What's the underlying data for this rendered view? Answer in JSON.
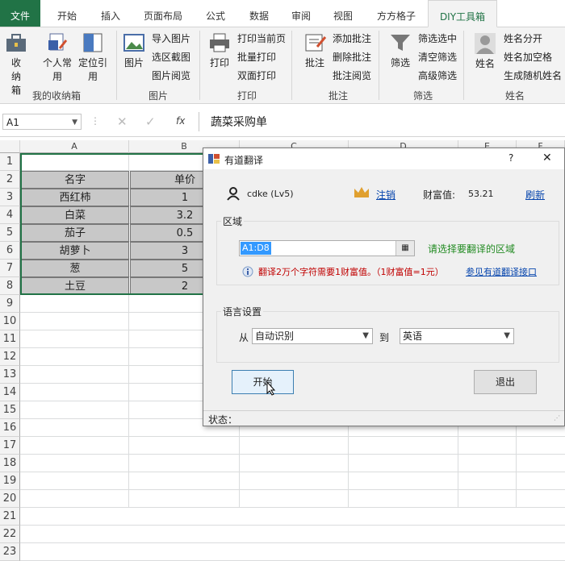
{
  "ribbon_tabs": [
    "文件",
    "开始",
    "插入",
    "页面布局",
    "公式",
    "数据",
    "审阅",
    "视图",
    "方方格子",
    "DIY工具箱"
  ],
  "ribbon": {
    "group1": {
      "big": [
        "收纳箱",
        "个人常用",
        "定位引用"
      ],
      "label": "我的收纳箱"
    },
    "group2": {
      "big": "图片",
      "small": [
        "导入图片",
        "选区截图",
        "图片阅览"
      ],
      "label": "图片"
    },
    "group3": {
      "big": "打印",
      "small": [
        "打印当前页",
        "批量打印",
        "双面打印"
      ],
      "label": "打印"
    },
    "group4": {
      "big": "批注",
      "small": [
        "添加批注",
        "删除批注",
        "批注阅览"
      ],
      "label": "批注"
    },
    "group5": {
      "big": "筛选",
      "small": [
        "筛选选中",
        "清空筛选",
        "高级筛选"
      ],
      "label": "筛选"
    },
    "group6": {
      "big": "姓名",
      "small": [
        "姓名分开",
        "姓名加空格",
        "生成随机姓名"
      ],
      "label": "姓名"
    }
  },
  "formula_bar": {
    "name_box": "A1",
    "fx": "fx",
    "value": "蔬菜采购单"
  },
  "columns": [
    "A",
    "B",
    "C",
    "D",
    "E",
    "F"
  ],
  "rows": [
    "1",
    "2",
    "3",
    "4",
    "5",
    "6",
    "7",
    "8",
    "9",
    "10",
    "11",
    "12",
    "13",
    "14",
    "15",
    "16",
    "17",
    "18",
    "19",
    "20",
    "21",
    "22",
    "23"
  ],
  "table": {
    "headers": [
      "名字",
      "单价"
    ],
    "rows": [
      [
        "西红柿",
        "1"
      ],
      [
        "白菜",
        "3.2"
      ],
      [
        "茄子",
        "0.5"
      ],
      [
        "胡萝卜",
        "3"
      ],
      [
        "葱",
        "5"
      ],
      [
        "土豆",
        "2"
      ]
    ]
  },
  "dialog": {
    "title": "有道翻译",
    "help": "?",
    "close": "✕",
    "user": "cdke (Lv5)",
    "logout": "注销",
    "wealth_label": "财富值:",
    "wealth_value": "53.21",
    "refresh": "刷新",
    "region_legend": "区域",
    "range_value": "A1:D8",
    "range_hint": "请选择要翻译的区域",
    "info_text": "翻译2万个字符需要1财富值。（1财富值=1元）",
    "info_link": "参见有道翻译接口",
    "lang_legend": "语言设置",
    "from_label": "从",
    "from_value": "自动识别",
    "to_label": "到",
    "to_value": "英语",
    "start_button": "开始",
    "exit_button": "退出",
    "status_label": "状态："
  },
  "colors": {
    "excel_green": "#217346",
    "selection_border": "#217346",
    "table_fill": "#c8c8c8",
    "info_text": "#c00000",
    "hint_text": "#228b22"
  }
}
